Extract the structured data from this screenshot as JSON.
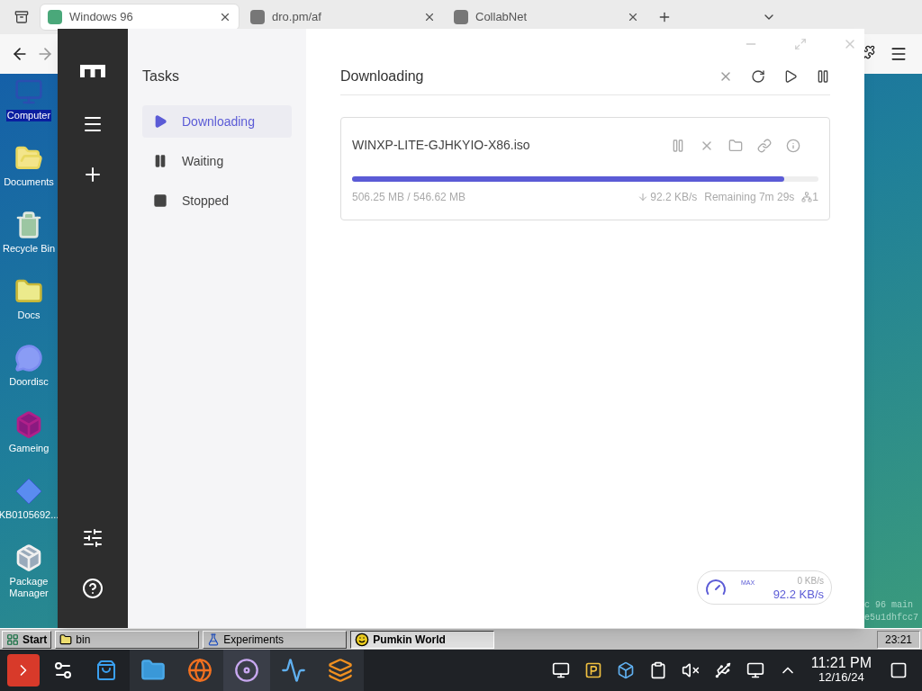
{
  "browser": {
    "tabs": [
      {
        "title": "Windows 96",
        "selected": true
      },
      {
        "title": "dro.pm/af",
        "selected": false
      },
      {
        "title": "CollabNet",
        "selected": false
      }
    ]
  },
  "desktop": {
    "icons": [
      {
        "label": "Computer",
        "kind": "computer",
        "selected": true
      },
      {
        "label": "Documents",
        "kind": "documents",
        "selected": false
      },
      {
        "label": "Recycle Bin",
        "kind": "recycle",
        "selected": false
      },
      {
        "label": "Docs",
        "kind": "folder",
        "selected": false
      },
      {
        "label": "Doordisc",
        "kind": "chat",
        "selected": false
      },
      {
        "label": "Gameing",
        "kind": "cube",
        "selected": false
      },
      {
        "label": "KB0105692...",
        "kind": "diamond",
        "selected": false
      },
      {
        "label": "Package Manager",
        "kind": "package",
        "selected": false
      }
    ],
    "corner_text": [
      "c 96 main",
      "e5u1dhfcc7"
    ]
  },
  "app": {
    "sidebar_title": "Tasks",
    "nav": [
      {
        "label": "Downloading",
        "kind": "play",
        "selected": true
      },
      {
        "label": "Waiting",
        "kind": "pause",
        "selected": false
      },
      {
        "label": "Stopped",
        "kind": "stop",
        "selected": false
      }
    ],
    "heading": "Downloading",
    "tasks": [
      {
        "name": "WINXP-LITE-GJHKYIO-X86.iso",
        "level": 0.926,
        "size": "506.25 MB / 546.62 MB",
        "speed": "92.2 KB/s",
        "remaining": "Remaining 7m 29s",
        "connections": "1"
      }
    ],
    "speed_meter": {
      "badge": "MAX",
      "limit": "0 KB/s",
      "speed": "92.2 KB/s"
    }
  },
  "win96_taskbar": {
    "start": "Start",
    "items": [
      {
        "label": "bin",
        "kind": "folder",
        "selected": false
      },
      {
        "label": "Experiments",
        "kind": "flask",
        "selected": false
      },
      {
        "label": "Pumkin World",
        "kind": "face",
        "selected": true
      }
    ],
    "clock": "23:21"
  },
  "taskbar": {
    "time": "11:21 PM",
    "date": "12/16/24"
  }
}
